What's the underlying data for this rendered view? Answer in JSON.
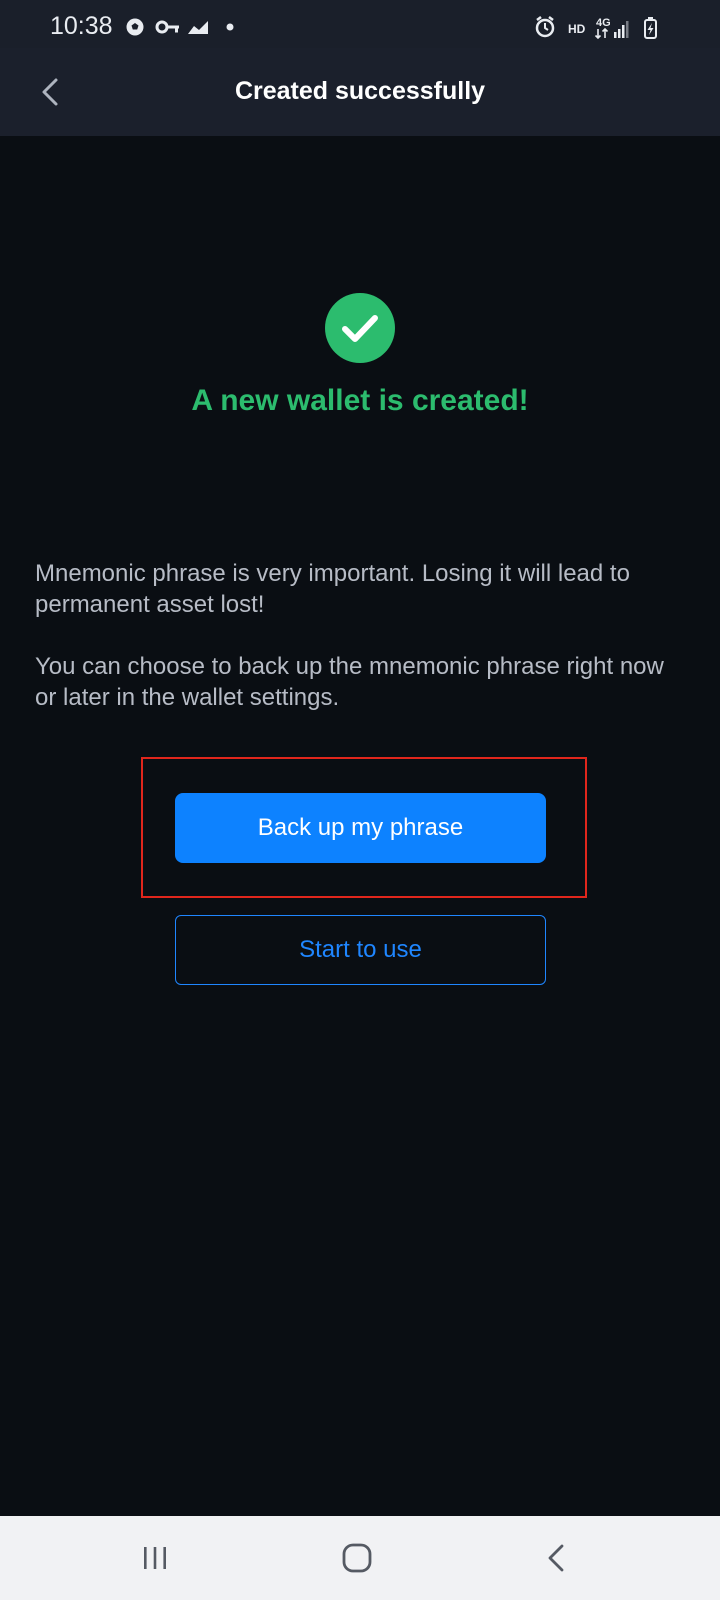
{
  "status_bar": {
    "time": "10:38",
    "icons": [
      "soccer-ball-icon",
      "key-icon",
      "stocks-icon",
      "dot-icon",
      "alarm-icon",
      "hd-icon",
      "4g-icon",
      "signal-icon",
      "battery-icon"
    ],
    "hd_label": "HD",
    "network_label": "4G"
  },
  "header": {
    "title": "Created successfully",
    "back_icon": "chevron-left-icon"
  },
  "success": {
    "icon": "checkmark-circle-icon",
    "heading": "A new wallet is created!"
  },
  "info": {
    "paragraph_1": "Mnemonic phrase is very important. Losing it will lead to permanent asset lost!",
    "paragraph_2": "You can choose to back up the mnemonic phrase right now or later in the wallet settings."
  },
  "actions": {
    "backup_label": "Back up my phrase",
    "start_label": "Start to use"
  },
  "system_nav": {
    "icons": [
      "recent-apps-icon",
      "home-icon",
      "back-icon"
    ]
  },
  "colors": {
    "background": "#0a0e13",
    "header": "#1b202c",
    "success_green": "#2cbc6e",
    "primary_blue": "#0d82ff",
    "highlight_red": "#e1261c",
    "body_text": "#b7bcc6"
  }
}
